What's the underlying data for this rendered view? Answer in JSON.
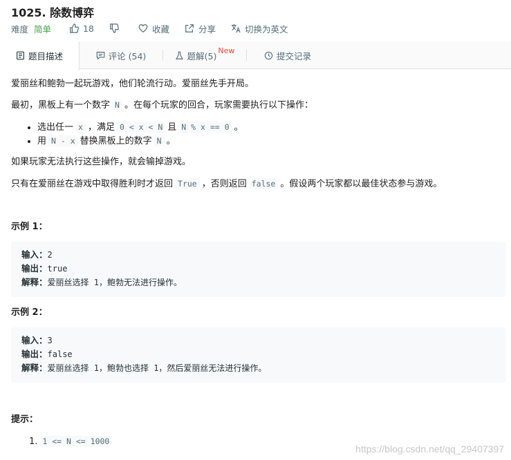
{
  "problem": {
    "title": "1025. 除数博弈",
    "difficulty_label": "难度",
    "difficulty": "简单",
    "likes": "18",
    "collect_label": "收藏",
    "share_label": "分享",
    "switch_lang_label": "切换为英文"
  },
  "tabs": [
    {
      "label": "题目描述",
      "icon": "document-icon"
    },
    {
      "label": "评论 (54)",
      "icon": "comment-icon"
    },
    {
      "label": "题解(5)",
      "icon": "flask-icon",
      "badge": "New"
    },
    {
      "label": "提交记录",
      "icon": "clock-icon"
    }
  ],
  "description": {
    "p1": "爱丽丝和鲍勃一起玩游戏，他们轮流行动。爱丽丝先手开局。",
    "p2_a": "最初，黑板上有一个数字",
    "p2_code": "N",
    "p2_b": "。在每个玩家的回合，玩家需要执行以下操作：",
    "b1_a": "选出任一",
    "b1_code1": "x",
    "b1_b": "，满足",
    "b1_code2": "0 < x < N",
    "b1_c": "且",
    "b1_code3": "N % x == 0",
    "b1_d": "。",
    "b2_a": "用",
    "b2_code1": "N - x",
    "b2_b": "替换黑板上的数字",
    "b2_code2": "N",
    "b2_c": "。",
    "p3": "如果玩家无法执行这些操作，就会输掉游戏。",
    "p4_a": "只有在爱丽丝在游戏中取得胜利时才返回",
    "p4_code1": "True",
    "p4_b": "，否则返回",
    "p4_code2": "false",
    "p4_c": "。假设两个玩家都以最佳状态参与游戏。"
  },
  "examples": [
    {
      "heading": "示例 1：",
      "in_label": "输入：",
      "in": "2",
      "out_label": "输出：",
      "out": "true",
      "exp_label": "解释：",
      "exp": "爱丽丝选择 1，鲍勃无法进行操作。"
    },
    {
      "heading": "示例 2：",
      "in_label": "输入：",
      "in": "3",
      "out_label": "输出：",
      "out": "false",
      "exp_label": "解释：",
      "exp": "爱丽丝选择 1，鲍勃也选择 1，然后爱丽丝无法进行操作。"
    }
  ],
  "hints": {
    "heading": "提示：",
    "item1_num": "1.",
    "item1": "1 <= N <= 1000"
  },
  "watermark": "https://blog.csdn.net/qq_29407397",
  "colors": {
    "easy": "#43a047",
    "new_badge": "#f44336",
    "code_bg": "#f7f9fa"
  }
}
